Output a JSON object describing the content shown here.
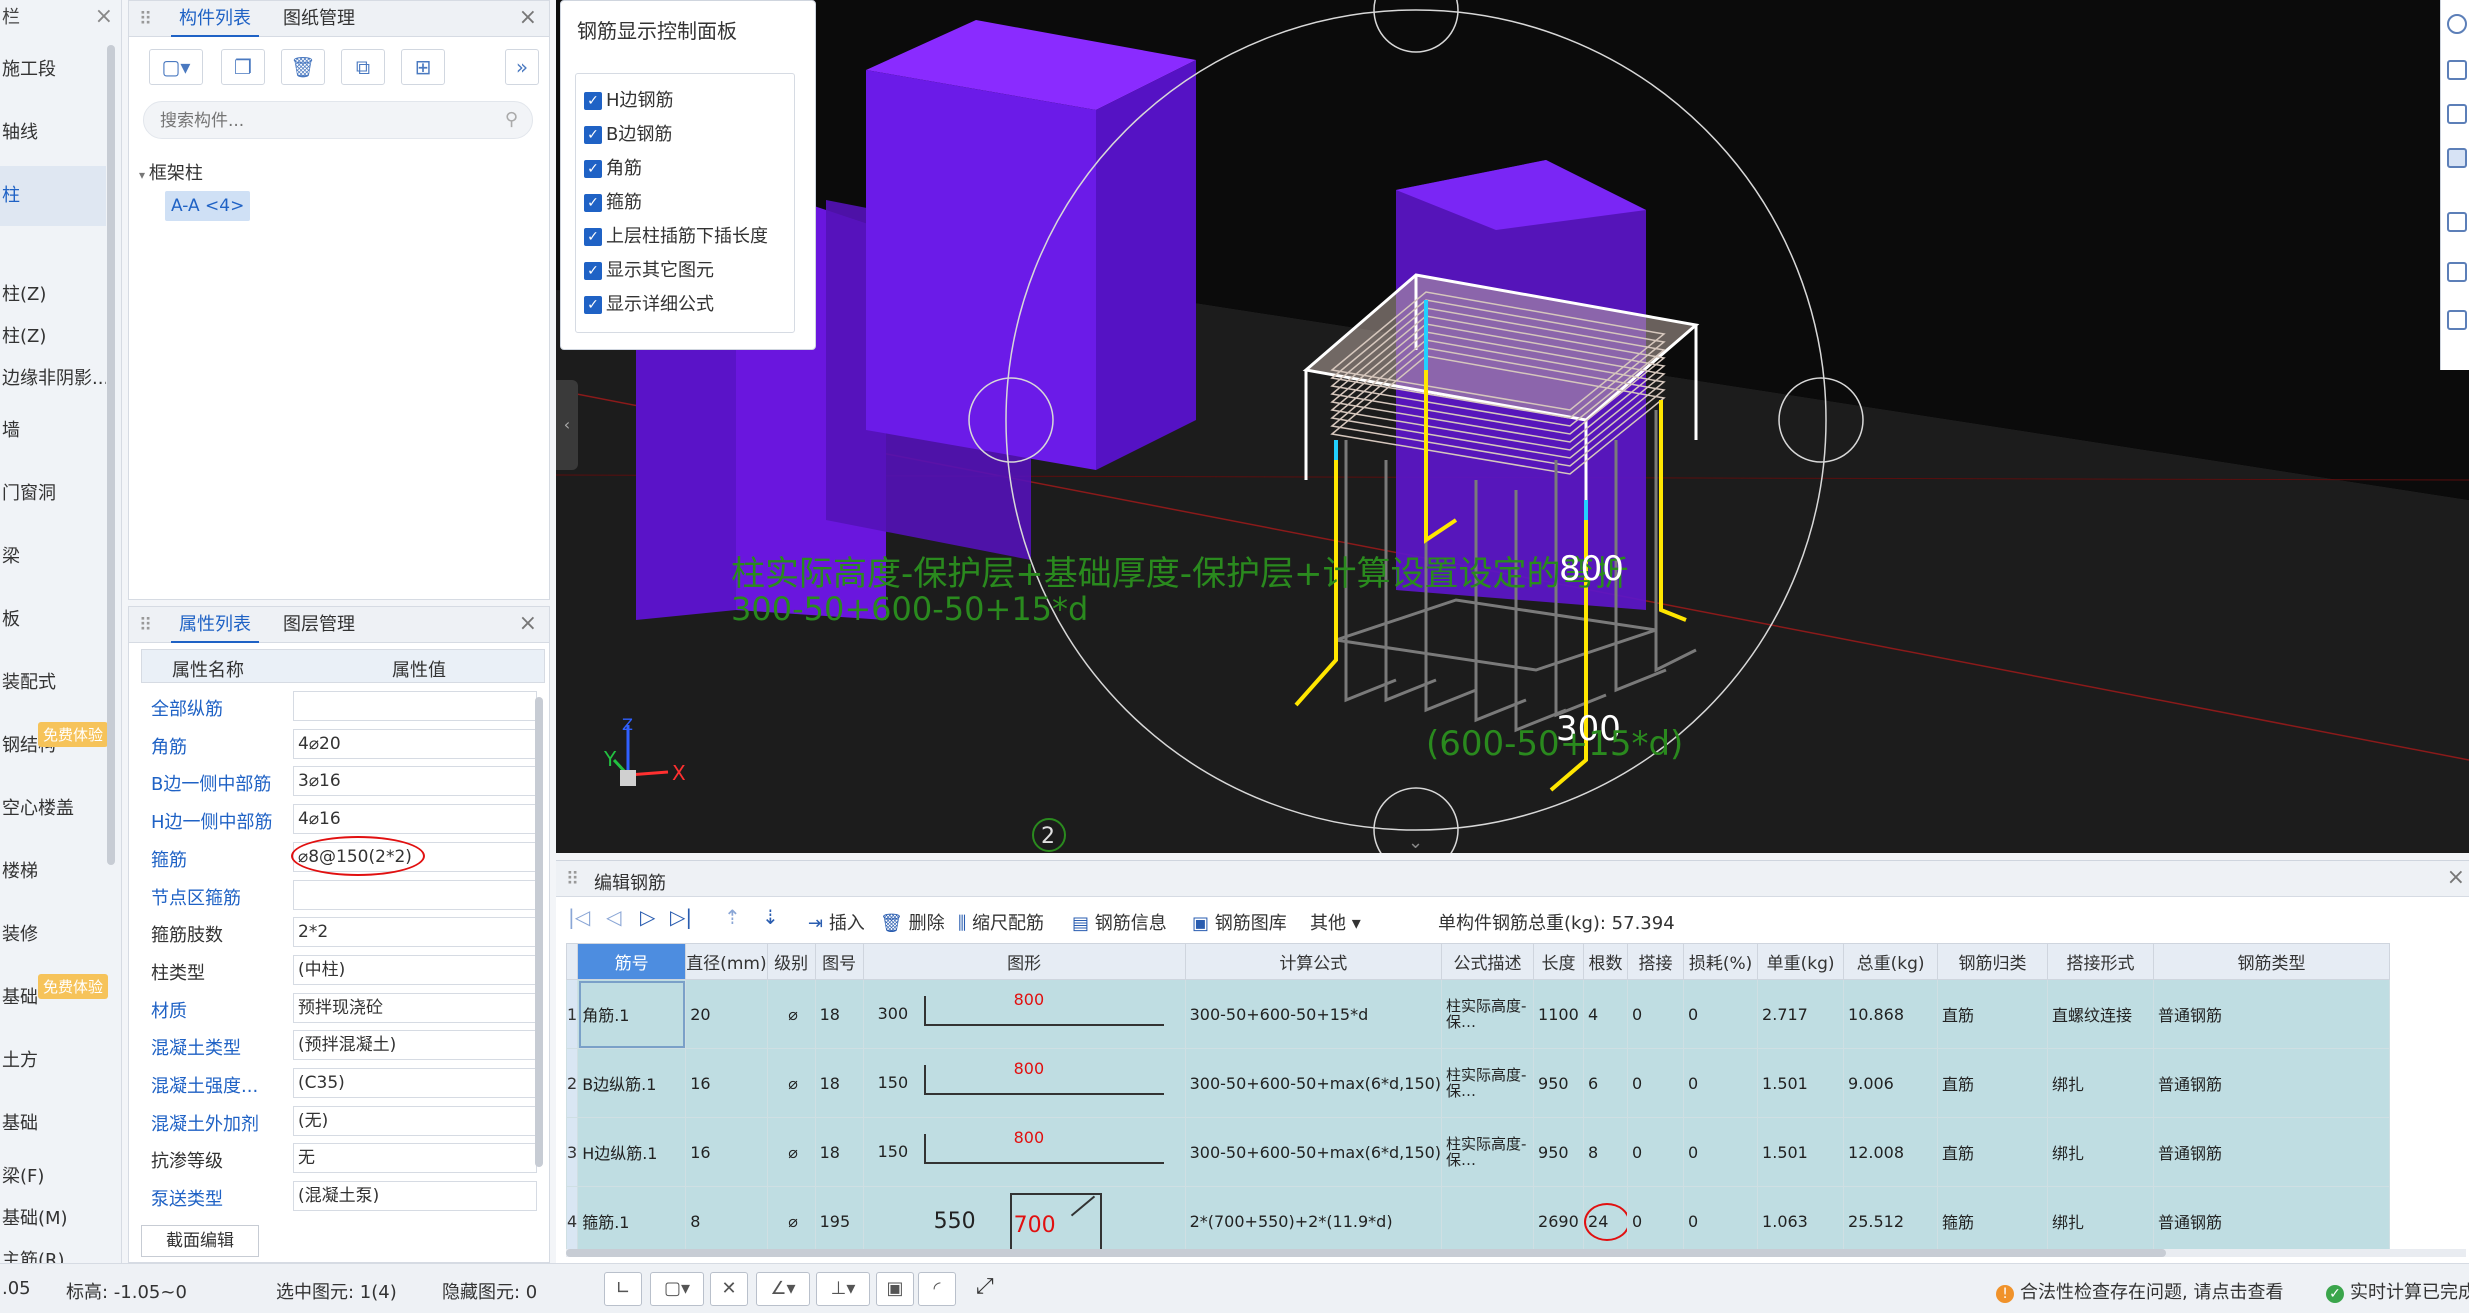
{
  "nav": {
    "title": "栏",
    "items": [
      "施工段",
      "轴线",
      "柱",
      "",
      "柱(Z)",
      "柱(Z)",
      "边缘非阴影...",
      "墙",
      "门窗洞",
      "梁",
      "板",
      "装配式",
      "钢结构",
      "空心楼盖",
      "楼梯",
      "装修",
      "基础",
      "土方",
      "基础",
      "梁(F)",
      "基础(M)",
      "主筋(R)"
    ],
    "badge": "免费体验"
  },
  "component_panel": {
    "tab_active": "构件列表",
    "tab_other": "图纸管理",
    "search_placeholder": "搜索构件...",
    "tree_root": "框架柱",
    "tree_leaf": "A-A <4>"
  },
  "property_panel": {
    "tab_active": "属性列表",
    "tab_other": "图层管理",
    "col_name": "属性名称",
    "col_value": "属性值",
    "rows": [
      {
        "name": "全部纵筋",
        "value": ""
      },
      {
        "name": "角筋",
        "value": "4⌀20"
      },
      {
        "name": "B边一侧中部筋",
        "value": "3⌀16"
      },
      {
        "name": "H边一侧中部筋",
        "value": "4⌀16"
      },
      {
        "name": "箍筋",
        "value": "⌀8@150(2*2)"
      },
      {
        "name": "节点区箍筋",
        "value": ""
      },
      {
        "name": "箍筋肢数",
        "value": "2*2"
      },
      {
        "name": "柱类型",
        "value": "(中柱)"
      },
      {
        "name": "材质",
        "value": "预拌现浇砼"
      },
      {
        "name": "混凝土类型",
        "value": "(预拌混凝土)"
      },
      {
        "name": "混凝土强度...",
        "value": "(C35)"
      },
      {
        "name": "混凝土外加剂",
        "value": "(无)"
      },
      {
        "name": "抗渗等级",
        "value": "无"
      },
      {
        "name": "泵送类型",
        "value": "(混凝土泵)"
      }
    ],
    "section_button": "截面编辑"
  },
  "control_panel": {
    "title": "钢筋显示控制面板",
    "options": [
      "H边钢筋",
      "B边钢筋",
      "角筋",
      "箍筋",
      "上层柱插筋下插长度",
      "显示其它图元",
      "显示详细公式"
    ]
  },
  "viewport": {
    "formula_text": "柱实际高度-保护层+基础厚度-保护层+计算设置设定的弯折",
    "formula_expr": "300-50+600-50+15*d",
    "dim_label": "300",
    "dim_label2": "(600-50+15*d)",
    "axis_label": "2",
    "axis_x": "X",
    "axis_y": "Y",
    "axis_z": "Z"
  },
  "editor": {
    "title": "编辑钢筋",
    "tools": {
      "insert": "插入",
      "delete": "删除",
      "scale": "缩尺配筋",
      "info": "钢筋信息",
      "library": "钢筋图库",
      "other": "其他",
      "total_label": "单构件钢筋总重(kg): 57.394"
    },
    "columns": [
      "筋号",
      "直径(mm)",
      "级别",
      "图号",
      "图形",
      "计算公式",
      "公式描述",
      "长度",
      "根数",
      "搭接",
      "损耗(%)",
      "单重(kg)",
      "总重(kg)",
      "钢筋归类",
      "搭接形式",
      "钢筋类型"
    ],
    "rows": [
      {
        "num": "1",
        "name": "角筋.1",
        "dia": "20",
        "grade": "⌀",
        "fig": "18",
        "shape_left": "300",
        "shape_mid": "800",
        "formula": "300-50+600-50+15*d",
        "desc": "柱实际高度-保…",
        "length": "1100",
        "count": "4",
        "lap": "0",
        "loss": "0",
        "unit_w": "2.717",
        "total_w": "10.868",
        "cat": "直筋",
        "lap_type": "直螺纹连接",
        "type": "普通钢筋"
      },
      {
        "num": "2",
        "name": "B边纵筋.1",
        "dia": "16",
        "grade": "⌀",
        "fig": "18",
        "shape_left": "150",
        "shape_mid": "800",
        "formula": "300-50+600-50+max(6*d,150)",
        "desc": "柱实际高度-保…",
        "length": "950",
        "count": "6",
        "lap": "0",
        "loss": "0",
        "unit_w": "1.501",
        "total_w": "9.006",
        "cat": "直筋",
        "lap_type": "绑扎",
        "type": "普通钢筋"
      },
      {
        "num": "3",
        "name": "H边纵筋.1",
        "dia": "16",
        "grade": "⌀",
        "fig": "18",
        "shape_left": "150",
        "shape_mid": "800",
        "formula": "300-50+600-50+max(6*d,150)",
        "desc": "柱实际高度-保…",
        "length": "950",
        "count": "8",
        "lap": "0",
        "loss": "0",
        "unit_w": "1.501",
        "total_w": "12.008",
        "cat": "直筋",
        "lap_type": "绑扎",
        "type": "普通钢筋"
      },
      {
        "num": "4",
        "name": "箍筋.1",
        "dia": "8",
        "grade": "⌀",
        "fig": "195",
        "shape_left": "550",
        "shape_mid": "700",
        "formula": "2*(700+550)+2*(11.9*d)",
        "desc": "",
        "length": "2690",
        "count": "24",
        "lap": "0",
        "loss": "0",
        "unit_w": "1.063",
        "total_w": "25.512",
        "cat": "箍筋",
        "lap_type": "绑扎",
        "type": "普通钢筋"
      }
    ]
  },
  "status": {
    "left_num": ".05",
    "elevation": "标高:  -1.05~0",
    "selected": "选中图元: 1(4)",
    "hidden": "隐藏图元: 0",
    "warning": "合法性检查存在问题, 请点击查看",
    "realtime": "实时计算已完成"
  },
  "colors": {
    "accent": "#1f62c5",
    "row_bg": "#bfdde2",
    "purple": "#7a18ff",
    "green_text": "#2a8a1e",
    "yellow_rebar": "#ffe600",
    "annotation_red": "#e11010"
  }
}
